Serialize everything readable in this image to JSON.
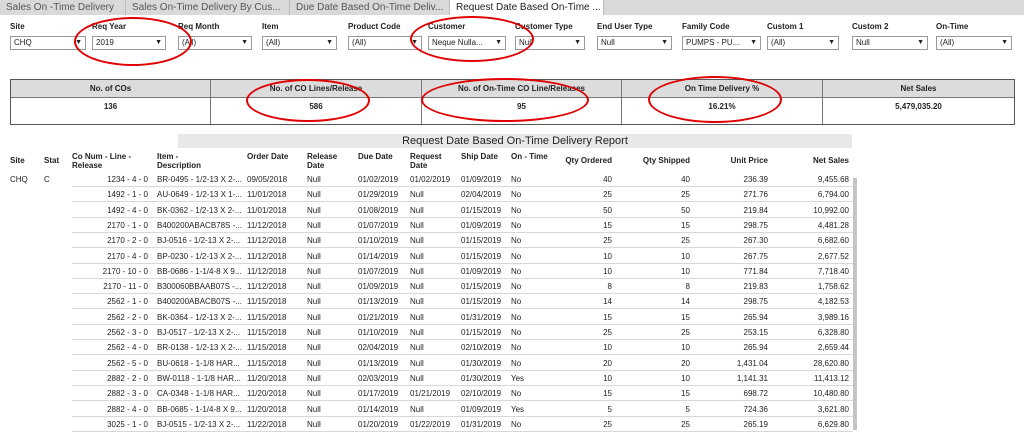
{
  "tabs": [
    {
      "label": "Sales On -Time Delivery"
    },
    {
      "label": "Sales On-Time Delivery By Cus..."
    },
    {
      "label": "Due Date Based On-Time Deliv..."
    },
    {
      "label": "Request Date Based On-Time ..."
    }
  ],
  "filters": [
    {
      "label": "Site",
      "value": "CHQ"
    },
    {
      "label": "Req Year",
      "value": "2019"
    },
    {
      "label": "Req Month",
      "value": "(All)"
    },
    {
      "label": "Item",
      "value": "(All)"
    },
    {
      "label": "Product Code",
      "value": "(All)"
    },
    {
      "label": "Customer",
      "value": "Neque Nulla..."
    },
    {
      "label": "Customer Type",
      "value": "Null"
    },
    {
      "label": "End User Type",
      "value": "Null"
    },
    {
      "label": "Family Code",
      "value": "PUMPS - PU..."
    },
    {
      "label": "Custom 1",
      "value": "(All)"
    },
    {
      "label": "Custom 2",
      "value": "Null"
    },
    {
      "label": "On-Time",
      "value": "(All)"
    }
  ],
  "kpis": [
    {
      "label": "No. of COs",
      "value": "136"
    },
    {
      "label": "No. of CO Lines/Release",
      "value": "586"
    },
    {
      "label": "No. of On-Time CO Line/Releases",
      "value": "95"
    },
    {
      "label": "On Time Delivery %",
      "value": "16.21%"
    },
    {
      "label": "Net Sales",
      "value": "5,479,035.20"
    }
  ],
  "report": {
    "title": "Request Date Based On-Time Delivery Report",
    "columns": [
      "Site",
      "Stat",
      "Co Num - Line - Release",
      "Item - Description",
      "Order Date",
      "Release Date",
      "Due Date",
      "Request Date",
      "Ship Date",
      "On - Time",
      "Qty Ordered",
      "Qty Shipped",
      "Unit Price",
      "Net Sales"
    ],
    "site": "CHQ",
    "stat": "C",
    "rows": [
      [
        "1234 - 4 - 0",
        "BR-0495 - 1/2-13 X 2-...",
        "09/05/2018",
        "Null",
        "01/02/2019",
        "01/02/2019",
        "01/09/2019",
        "No",
        "40",
        "40",
        "236.39",
        "9,455.68"
      ],
      [
        "1492 - 1 - 0",
        "AU-0649 - 1/2-13 X 1-...",
        "11/01/2018",
        "Null",
        "01/29/2019",
        "Null",
        "02/04/2019",
        "No",
        "25",
        "25",
        "271.76",
        "6,794.00"
      ],
      [
        "1492 - 4 - 0",
        "BK-0362 - 1/2-13 X 2-...",
        "11/01/2018",
        "Null",
        "01/08/2019",
        "Null",
        "01/15/2019",
        "No",
        "50",
        "50",
        "219.84",
        "10,992.00"
      ],
      [
        "2170 - 1 - 0",
        "B400200ABACB78S -...",
        "11/12/2018",
        "Null",
        "01/07/2019",
        "Null",
        "01/09/2019",
        "No",
        "15",
        "15",
        "298.75",
        "4,481.28"
      ],
      [
        "2170 - 2 - 0",
        "BJ-0516 - 1/2-13 X 2-...",
        "11/12/2018",
        "Null",
        "01/10/2019",
        "Null",
        "01/15/2019",
        "No",
        "25",
        "25",
        "267.30",
        "6,682.60"
      ],
      [
        "2170 - 4 - 0",
        "BP-0230 - 1/2-13 X 2-...",
        "11/12/2018",
        "Null",
        "01/14/2019",
        "Null",
        "01/15/2019",
        "No",
        "10",
        "10",
        "267.75",
        "2,677.52"
      ],
      [
        "2170 - 10 - 0",
        "BB-0686 - 1-1/4-8 X 9...",
        "11/12/2018",
        "Null",
        "01/07/2019",
        "Null",
        "01/09/2019",
        "No",
        "10",
        "10",
        "771.84",
        "7,718.40"
      ],
      [
        "2170 - 11 - 0",
        "B300060BBAAB07S -...",
        "11/12/2018",
        "Null",
        "01/09/2019",
        "Null",
        "01/15/2019",
        "No",
        "8",
        "8",
        "219.83",
        "1,758.62"
      ],
      [
        "2562 - 1 - 0",
        "B400200ABACB07S -...",
        "11/15/2018",
        "Null",
        "01/13/2019",
        "Null",
        "01/15/2019",
        "No",
        "14",
        "14",
        "298.75",
        "4,182.53"
      ],
      [
        "2562 - 2 - 0",
        "BK-0364 - 1/2-13 X 2-...",
        "11/15/2018",
        "Null",
        "01/21/2019",
        "Null",
        "01/31/2019",
        "No",
        "15",
        "15",
        "265.94",
        "3,989.16"
      ],
      [
        "2562 - 3 - 0",
        "BJ-0517 - 1/2-13 X 2-...",
        "11/15/2018",
        "Null",
        "01/10/2019",
        "Null",
        "01/15/2019",
        "No",
        "25",
        "25",
        "253.15",
        "6,328.80"
      ],
      [
        "2562 - 4 - 0",
        "BR-0138 - 1/2-13 X 2-...",
        "11/15/2018",
        "Null",
        "02/04/2019",
        "Null",
        "02/10/2019",
        "No",
        "10",
        "10",
        "265.94",
        "2,659.44"
      ],
      [
        "2562 - 5 - 0",
        "BU-0618 - 1-1/8 HAR...",
        "11/15/2018",
        "Null",
        "01/13/2019",
        "Null",
        "01/30/2019",
        "No",
        "20",
        "20",
        "1,431.04",
        "28,620.80"
      ],
      [
        "2882 - 2 - 0",
        "BW-0118 - 1-1/8 HAR...",
        "11/20/2018",
        "Null",
        "02/03/2019",
        "Null",
        "01/30/2019",
        "Yes",
        "10",
        "10",
        "1,141.31",
        "11,413.12"
      ],
      [
        "2882 - 3 - 0",
        "CA-0348 - 1-1/8 HAR...",
        "11/20/2018",
        "Null",
        "01/17/2019",
        "01/21/2019",
        "02/10/2019",
        "No",
        "15",
        "15",
        "698.72",
        "10,480.80"
      ],
      [
        "2882 - 4 - 0",
        "BB-0685 - 1-1/4-8 X 9...",
        "11/20/2018",
        "Null",
        "01/14/2019",
        "Null",
        "01/09/2019",
        "Yes",
        "5",
        "5",
        "724.36",
        "3,621.80"
      ],
      [
        "3025 - 1 - 0",
        "BJ-0515 - 1/2-13 X 2-...",
        "11/22/2018",
        "Null",
        "01/20/2019",
        "01/22/2019",
        "01/31/2019",
        "No",
        "25",
        "25",
        "265.19",
        "6,629.80"
      ]
    ]
  },
  "colors": {
    "annotation_circle": "#e00000",
    "header_bg": "#dcdcdc"
  }
}
